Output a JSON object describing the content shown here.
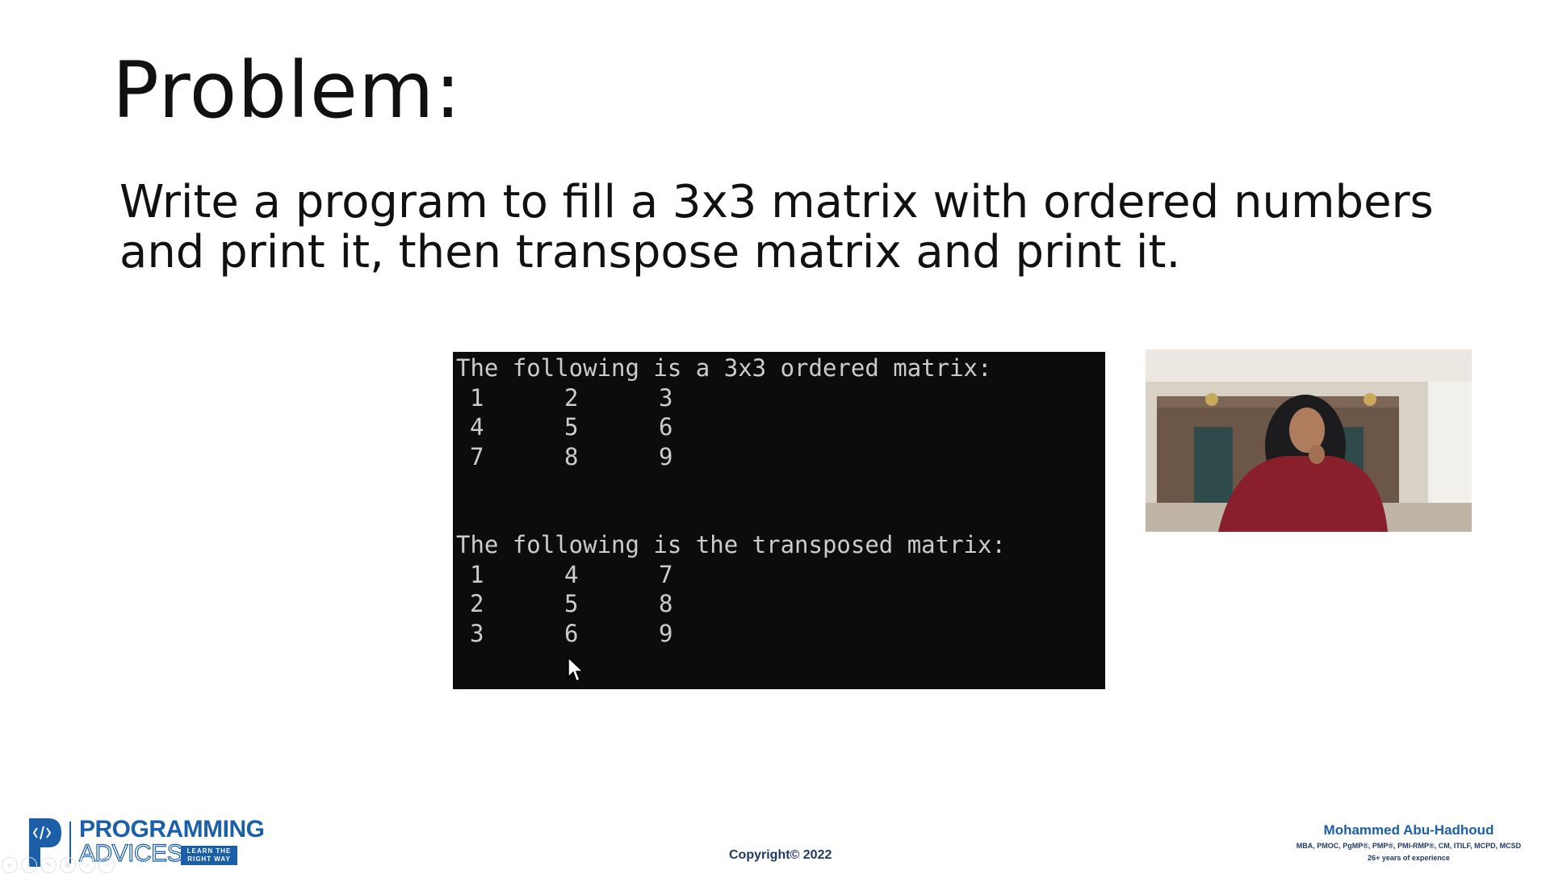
{
  "slide": {
    "title": "Problem:",
    "problem_lines": [
      "Write a program to fill a 3x3 matrix with ordered numbers",
      "and print it, then transpose matrix  and print it."
    ]
  },
  "terminal": {
    "header1": "The following is a 3x3 ordered matrix:",
    "matrix": [
      [
        "1",
        "2",
        "3"
      ],
      [
        "4",
        "5",
        "6"
      ],
      [
        "7",
        "8",
        "9"
      ]
    ],
    "header2": "The following is the transposed matrix:",
    "transposed": [
      [
        "1",
        "4",
        "7"
      ],
      [
        "2",
        "5",
        "8"
      ],
      [
        "3",
        "6",
        "9"
      ]
    ]
  },
  "footer": {
    "brand_name": "PROGRAMMING",
    "brand_sub": "ADVICES",
    "brand_tag_line1": "LEARN THE",
    "brand_tag_line2": "RIGHT WAY",
    "copyright": "Copyright© 2022",
    "author_name": "Mohammed Abu-Hadhoud",
    "author_credentials": "MBA, PMOC, PgMP®, PMP®, PMI-RMP®, CM, ITILF, MCPD, MCSD",
    "author_experience": "26+ years of experience"
  },
  "icons": {
    "brand_logo": "programming-advices-logo-icon",
    "cursor": "mouse-pointer-icon",
    "player_controls": [
      "rewind-icon",
      "previous-icon",
      "edit-icon",
      "zoom-icon",
      "search-icon",
      "minus-icon"
    ]
  },
  "colors": {
    "brand_blue": "#1a5fa8",
    "terminal_bg": "#0c0c0c",
    "terminal_text": "#cccccc",
    "footer_text": "#1f3a66"
  }
}
